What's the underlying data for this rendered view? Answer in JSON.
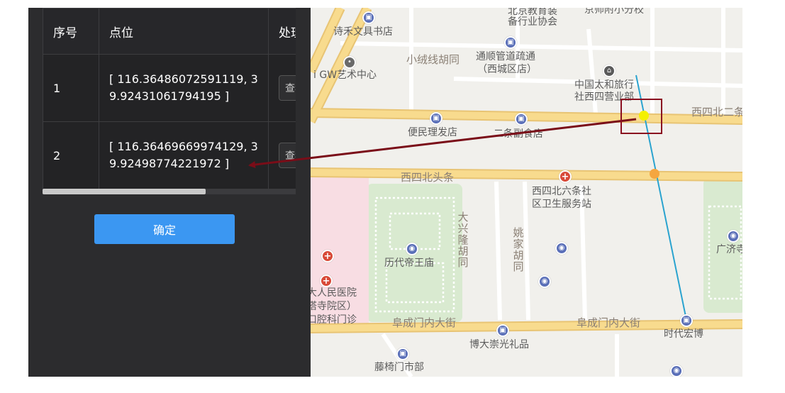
{
  "table": {
    "headers": [
      "序号",
      "点位",
      "处理"
    ],
    "rows": [
      {
        "index": "1",
        "coordinate": "[ 116.36486072591119, 39.92431061794195 ]",
        "action": "查看"
      },
      {
        "index": "2",
        "coordinate": "[ 116.36469669974129, 39.92498774221972 ]",
        "action": "查看"
      }
    ]
  },
  "confirm_label": "确定",
  "map": {
    "labels": {
      "bookstore": "诗禾文具书店",
      "edu_top1": "北京教育装",
      "edu_top2": "备行业协会",
      "school_top": "京师附小分校",
      "xiaorongxian": "小绒线胡同",
      "pipe1": "通顺管道疏通",
      "pipe2": "（西城区店）",
      "art": "i GW艺术中心",
      "travel1": "中国太和旅行",
      "travel2": "社西四营业部",
      "xisibei2": "西四北二条",
      "barber": "便民理发店",
      "grocery": "二条副食店",
      "xisibeitoutiao": "西四北头条",
      "health1": "西四北六条社",
      "health2": "区卫生服务站",
      "daxinglong": "大兴隆胡同",
      "yaojia": "姚家胡同",
      "lidai": "历代帝王庙",
      "guangji": "广济寺",
      "hospital1": "大人民医院",
      "hospital2": "塔寺院区）",
      "hospital3": "口腔科门诊",
      "fuchengmen_w": "阜成门内大街",
      "fuchengmen_e": "阜成门内大街",
      "bodachong": "博大崇光礼品",
      "shidai": "时代宏博",
      "tengyi": "藤椅门市部"
    }
  },
  "colors": {
    "panel_bg": "#2c2c2e",
    "confirm_bg": "#3b97f2",
    "arrow": "#7a0d18",
    "highlight_box": "#8a1020",
    "marker_yellow": "#f4f000",
    "marker_orange": "#f5a640",
    "track_line": "#2aa3cf",
    "road_major": "#f6d88a"
  },
  "icons": [
    "shopping-bag-icon",
    "cart-icon",
    "hospital-cross-icon",
    "camera-icon",
    "bank-icon",
    "restaurant-icon"
  ]
}
